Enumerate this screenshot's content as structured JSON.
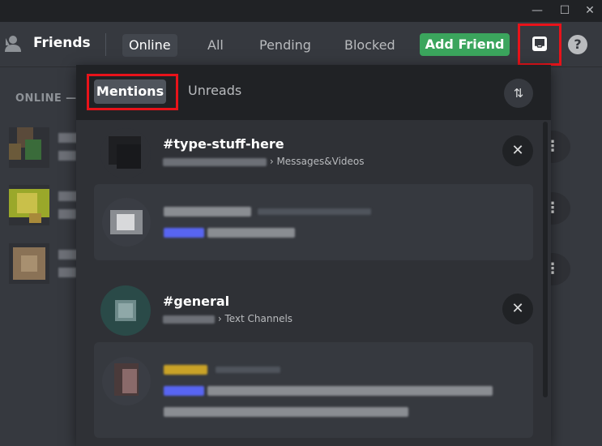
{
  "titlebar": {
    "minimize_icon": "minimize-icon",
    "maximize_icon": "maximize-icon",
    "close_icon": "close-icon",
    "min_glyph": "—",
    "max_glyph": "☐",
    "close_glyph": "✕"
  },
  "header": {
    "title": "Friends",
    "tabs": [
      {
        "label": "Online",
        "active": true
      },
      {
        "label": "All",
        "active": false
      },
      {
        "label": "Pending",
        "active": false
      },
      {
        "label": "Blocked",
        "active": false
      }
    ],
    "add_friend_label": "Add Friend",
    "inbox_icon": "inbox-icon",
    "help_icon": "help-icon",
    "help_glyph": "?"
  },
  "friends_list": {
    "section_label": "ONLINE —",
    "menu_glyph": "⋮"
  },
  "inbox": {
    "tabs": {
      "mentions": "Mentions",
      "unreads": "Unreads"
    },
    "filter_icon": "sort-icon",
    "filter_glyph": "⇅",
    "close_glyph": "✕",
    "channels": [
      {
        "name": "#type-stuff-here",
        "category": "› Messages&Videos"
      },
      {
        "name": "#general",
        "category": "› Text Channels"
      }
    ]
  },
  "colors": {
    "background": "#36393f",
    "popout": "#2f3136",
    "header_dark": "#202225",
    "accent_green": "#3ba55d",
    "highlight_red": "#e8131a",
    "mention_blue": "#5865f2",
    "username_gold": "#c9a227"
  }
}
